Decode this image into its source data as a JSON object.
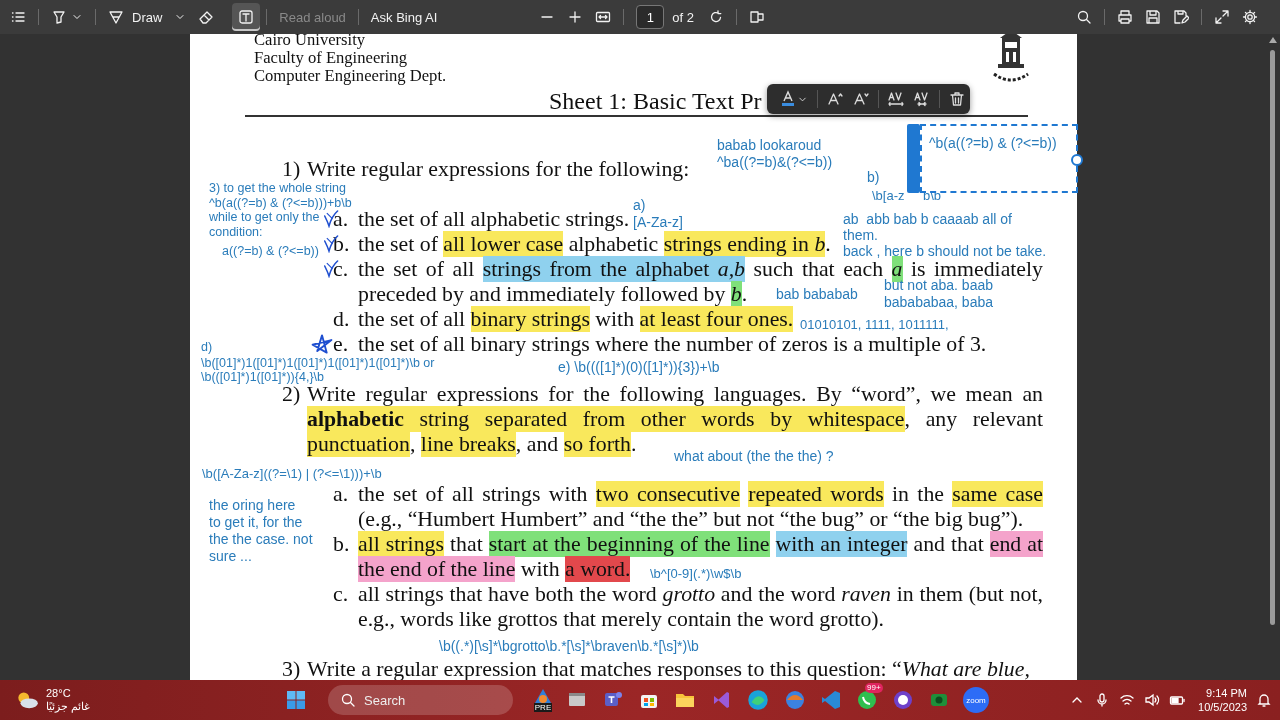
{
  "toolbar": {
    "draw_label": "Draw",
    "text_tool_selected": true,
    "read_aloud": {
      "label": "Read aloud",
      "disabled": true
    },
    "ask_label": "Ask Bing AI",
    "page_number": "1",
    "page_count": "of 2"
  },
  "document": {
    "header": [
      "Cairo University",
      "Faculty of Engineering",
      "Computer Engineering Dept."
    ],
    "title": "Sheet 1: Basic Text Pr",
    "questions": [
      {
        "number": "1)",
        "segments": [
          {
            "text": "Write regular expressions for the following:"
          }
        ],
        "items": [
          {
            "letter": "a.",
            "ticked": true,
            "starred": false,
            "segments": [
              {
                "text": "the set of all alphabetic strings."
              }
            ]
          },
          {
            "letter": "b.",
            "ticked": true,
            "starred": false,
            "segments": [
              {
                "text": "the set of "
              },
              {
                "text": "all lower case",
                "color": "#f9e85c"
              },
              {
                "text": " alphabetic "
              },
              {
                "text": "strings ending in *b*",
                "color": "#f9e85c"
              },
              {
                "text": "."
              }
            ]
          },
          {
            "letter": "c.",
            "ticked": true,
            "starred": false,
            "segments": [
              {
                "text": "the set of all "
              },
              {
                "text": "strings from the alphabet *a,b*",
                "color": "#8fd1ee"
              },
              {
                "text": " such that each "
              },
              {
                "text": "*a*",
                "color": "#7fe07a"
              },
              {
                "text": " is immediately preceded by and immediately followed by "
              },
              {
                "text": "*b*",
                "color": "#7fe07a"
              },
              {
                "text": "."
              }
            ]
          },
          {
            "letter": "d.",
            "ticked": false,
            "starred": false,
            "segments": [
              {
                "text": "the set of all "
              },
              {
                "text": "binary strings",
                "color": "#f9e85c"
              },
              {
                "text": " with "
              },
              {
                "text": "at least four ones.",
                "color": "#f9e85c"
              }
            ]
          },
          {
            "letter": "e.",
            "ticked": false,
            "starred": true,
            "segments": [
              {
                "text": "the set of all binary strings where the number of zeros is a multiple of 3."
              }
            ]
          }
        ]
      },
      {
        "number": "2)",
        "segments": [
          {
            "text": "Write regular expressions for the following languages. By “word”, we mean an "
          },
          {
            "text": "**alphabetic** string separated from other words by whitespace",
            "color": "#f9e85c"
          },
          {
            "text": ", any relevant "
          },
          {
            "text": "punctuation",
            "color": "#f9e85c"
          },
          {
            "text": ", "
          },
          {
            "text": "line breaks",
            "color": "#f9e85c"
          },
          {
            "text": ", and "
          },
          {
            "text": "so forth",
            "color": "#f9e85c"
          },
          {
            "text": "."
          }
        ],
        "items": [
          {
            "letter": "a.",
            "ticked": false,
            "starred": false,
            "segments": [
              {
                "text": "the set of all strings with "
              },
              {
                "text": "two consecutive ",
                "color": "#f9e85c"
              },
              {
                "text": "repeated words",
                "color": "#f9e85c"
              },
              {
                "text": " in the "
              },
              {
                "text": "same case",
                "color": "#f9e85c"
              },
              {
                "text": " (e.g., “Humbert Humbert” and “the the” but not “the bug” or “the big bug”)."
              }
            ]
          },
          {
            "letter": "b.",
            "ticked": false,
            "starred": false,
            "segments": [
              {
                "text": "all strings",
                "color": "#f9e85c"
              },
              {
                "text": " that "
              },
              {
                "text": "start at the beginning of the line ",
                "color": "#7fe07a"
              },
              {
                "text": "with an integer",
                "color": "#8fd1ee"
              },
              {
                "text": " and that "
              },
              {
                "text": "end at the end of the line",
                "color": "#f4a3cb"
              },
              {
                "text": " with "
              },
              {
                "text": "a word.",
                "color": "#e2484c"
              }
            ]
          },
          {
            "letter": "c.",
            "ticked": false,
            "starred": false,
            "segments": [
              {
                "text": "all strings that have both the word *grotto* and the word *raven* in them (but not, e.g., words like grottos that merely contain the word grotto)."
              }
            ]
          }
        ]
      },
      {
        "number": "3)",
        "segments": [
          {
            "text": "Write a regular expression that matches responses to this question: “*What are blue,*"
          }
        ]
      }
    ]
  },
  "annotations": [
    {
      "text": "3) to get the whole string\n^b(a((?=b) & (?<=b)))+b\\b"
    },
    {
      "text": "while to get only the\ncondition:"
    },
    {
      "text": "a((?=b) & (?<=b))"
    },
    {
      "text": "a)\n[A-Za-z]"
    },
    {
      "text": "babab lookaroud\n^ba((?=b)&(?<=b))"
    },
    {
      "text": "b)"
    },
    {
      "text": "\\b[a-z"
    },
    {
      "text": "b\\b"
    },
    {
      "text": "ab  abb bab b caaaab all of\nthem.\nback , here b should not be take."
    },
    {
      "text": "bab bababab"
    },
    {
      "text": "but not aba. baab\nbabababaa, baba"
    },
    {
      "text": "01010101, 1111, 1011111,"
    },
    {
      "text": "d)"
    },
    {
      "text": "\\b([01]*)1([01]*)1([01]*)1([01]*)1([01]*)\\b or\n\\b(([01]*)1([01]*)){4,}\\b"
    },
    {
      "text": "e) \\b((([1]*)(0)([1]*)){3})+\\b"
    },
    {
      "text": "what about (the the the) ?"
    },
    {
      "text": "\\b([A-Za-z]((?=\\1) | (?<=\\1)))+\\b"
    },
    {
      "text": "the oring here\nto get it, for the\nthe the case. not\nsure ..."
    },
    {
      "text": "\\b^[0-9](.*)\\w$\\b"
    },
    {
      "text": "\\b((.*)[\\s]*\\bgrotto\\b.*[\\s]*\\braven\\b.*[\\s]*)\\b"
    }
  ],
  "selected_text_box": {
    "text": "^b(a((?=b) & (?<=b))",
    "selected": true
  },
  "taskbar": {
    "temperature": "28°C",
    "weather": "غائم جزئيًا",
    "search_label": "Search",
    "pre_label": "PRE",
    "notification_badge": "99+",
    "zoom_label": "zoom",
    "time": "9:14 PM",
    "date": "10/5/2023"
  }
}
